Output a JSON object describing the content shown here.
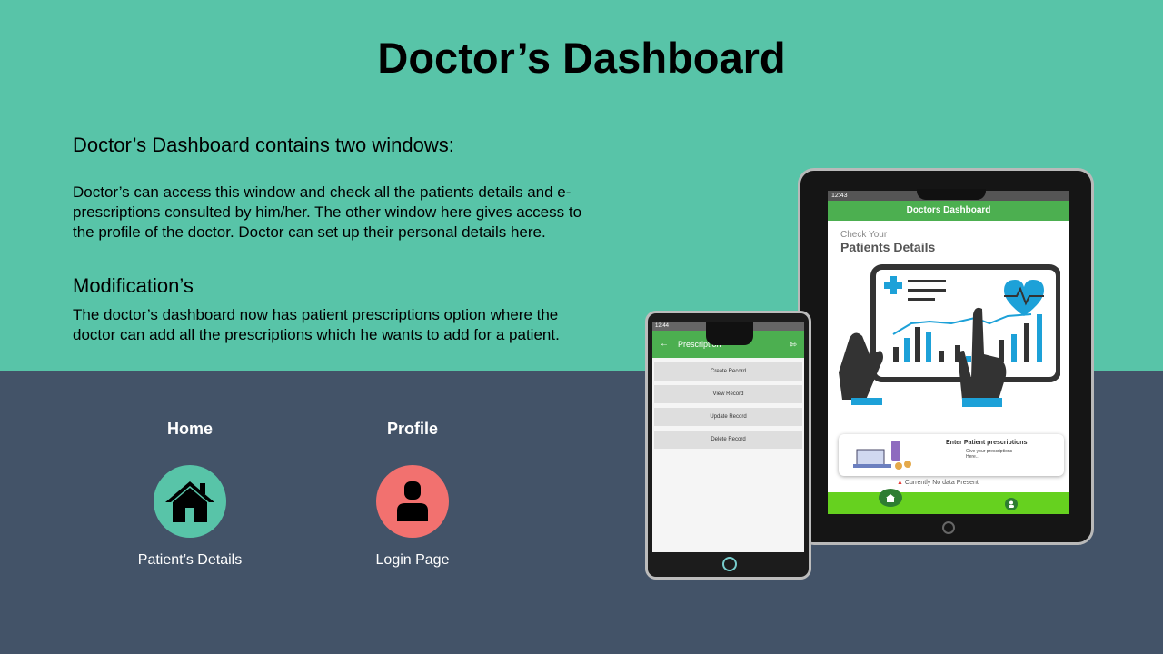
{
  "title": "Doctor’s Dashboard",
  "intro": "Doctor’s Dashboard contains two windows:",
  "paragraph1": "Doctor’s can access this window and check all the patients details and e-prescriptions consulted by him/her. The other window here gives access to the profile of the doctor. Doctor can set up their personal details here.",
  "modifications_heading": "Modification’s",
  "paragraph2": "The doctor’s dashboard now has patient prescriptions option where the doctor can add all the prescriptions which he wants to add for a patient.",
  "nav": {
    "home": {
      "title": "Home",
      "subtitle": "Patient’s Details",
      "icon": "home-icon",
      "color": "#58c4a8"
    },
    "profile": {
      "title": "Profile",
      "subtitle": "Login Page",
      "icon": "person-icon",
      "color": "#f2716f"
    }
  },
  "tablet": {
    "status": "12:43",
    "appbar_title": "Doctors Dashboard",
    "check_label": "Check Your",
    "patients_label": "Patients Details",
    "card_title": "Enter Patient prescriptions",
    "card_sub": "Give your prescriptions Here..",
    "no_data": "Currently No data Present"
  },
  "phone": {
    "status": "12:44",
    "appbar_title": "Prescription",
    "buttons": [
      "Create Record",
      "View Record",
      "Update Record",
      "Delete Record"
    ]
  },
  "colors": {
    "top": "#58c4a8",
    "bottom": "#435368",
    "green": "#4caf50"
  }
}
